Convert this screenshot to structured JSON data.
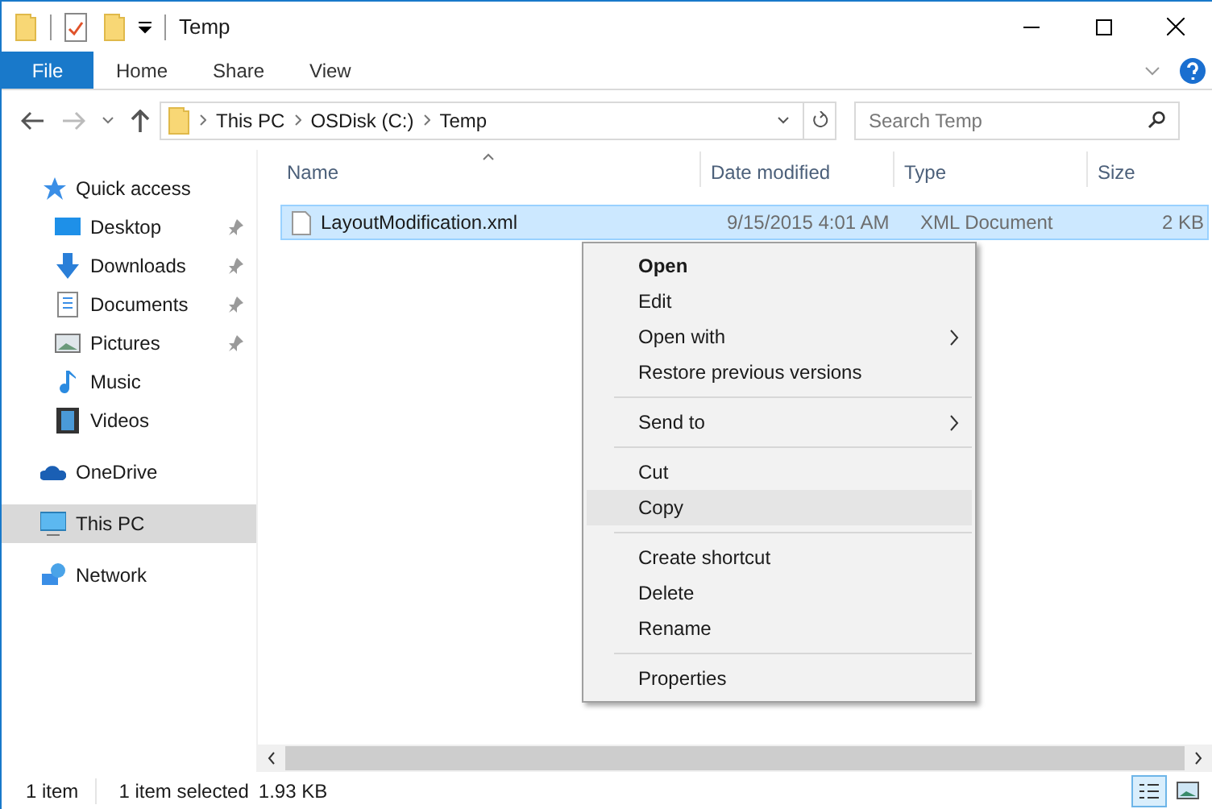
{
  "window": {
    "title": "Temp"
  },
  "ribbon_tabs": [
    {
      "label": "File",
      "selected": true
    },
    {
      "label": "Home",
      "selected": false
    },
    {
      "label": "Share",
      "selected": false
    },
    {
      "label": "View",
      "selected": false
    }
  ],
  "breadcrumb": [
    "This PC",
    "OSDisk (C:)",
    "Temp"
  ],
  "search": {
    "placeholder": "Search Temp"
  },
  "sidebar": [
    {
      "label": "Quick access",
      "kind": "star",
      "selected": false,
      "children": [
        {
          "label": "Desktop",
          "kind": "desktop",
          "pinned": true,
          "selected": false
        },
        {
          "label": "Downloads",
          "kind": "download",
          "pinned": true,
          "selected": false
        },
        {
          "label": "Documents",
          "kind": "documents",
          "pinned": true,
          "selected": false
        },
        {
          "label": "Pictures",
          "kind": "pictures",
          "pinned": true,
          "selected": false
        },
        {
          "label": "Music",
          "kind": "music",
          "pinned": false,
          "selected": false
        },
        {
          "label": "Videos",
          "kind": "videos",
          "pinned": false,
          "selected": false
        }
      ]
    },
    {
      "label": "OneDrive",
      "kind": "cloud",
      "selected": false
    },
    {
      "label": "This PC",
      "kind": "computer",
      "selected": true
    },
    {
      "label": "Network",
      "kind": "network",
      "selected": false
    }
  ],
  "table": {
    "columns": [
      "Name",
      "Date modified",
      "Type",
      "Size"
    ],
    "rows": [
      {
        "name": "LayoutModification.xml",
        "date": "9/15/2015 4:01 AM",
        "type": "XML Document",
        "size": "2 KB",
        "selected": true
      }
    ]
  },
  "context_menu": [
    {
      "kind": "item",
      "label": "Open",
      "bold": true,
      "submenu": false,
      "selected": false
    },
    {
      "kind": "item",
      "label": "Edit",
      "bold": false,
      "submenu": false,
      "selected": false
    },
    {
      "kind": "item",
      "label": "Open with",
      "bold": false,
      "submenu": true,
      "selected": false
    },
    {
      "kind": "item",
      "label": "Restore previous versions",
      "bold": false,
      "submenu": false,
      "selected": false
    },
    {
      "kind": "separator"
    },
    {
      "kind": "item",
      "label": "Send to",
      "bold": false,
      "submenu": true,
      "selected": false
    },
    {
      "kind": "separator"
    },
    {
      "kind": "item",
      "label": "Cut",
      "bold": false,
      "submenu": false,
      "selected": false
    },
    {
      "kind": "item",
      "label": "Copy",
      "bold": false,
      "submenu": false,
      "selected": true
    },
    {
      "kind": "separator"
    },
    {
      "kind": "item",
      "label": "Create shortcut",
      "bold": false,
      "submenu": false,
      "selected": false
    },
    {
      "kind": "item",
      "label": "Delete",
      "bold": false,
      "submenu": false,
      "selected": false
    },
    {
      "kind": "item",
      "label": "Rename",
      "bold": false,
      "submenu": false,
      "selected": false
    },
    {
      "kind": "separator"
    },
    {
      "kind": "item",
      "label": "Properties",
      "bold": false,
      "submenu": false,
      "selected": false
    }
  ],
  "status_bar": {
    "count": "1 item",
    "selection": "1 item selected",
    "size": "1.93 KB"
  }
}
